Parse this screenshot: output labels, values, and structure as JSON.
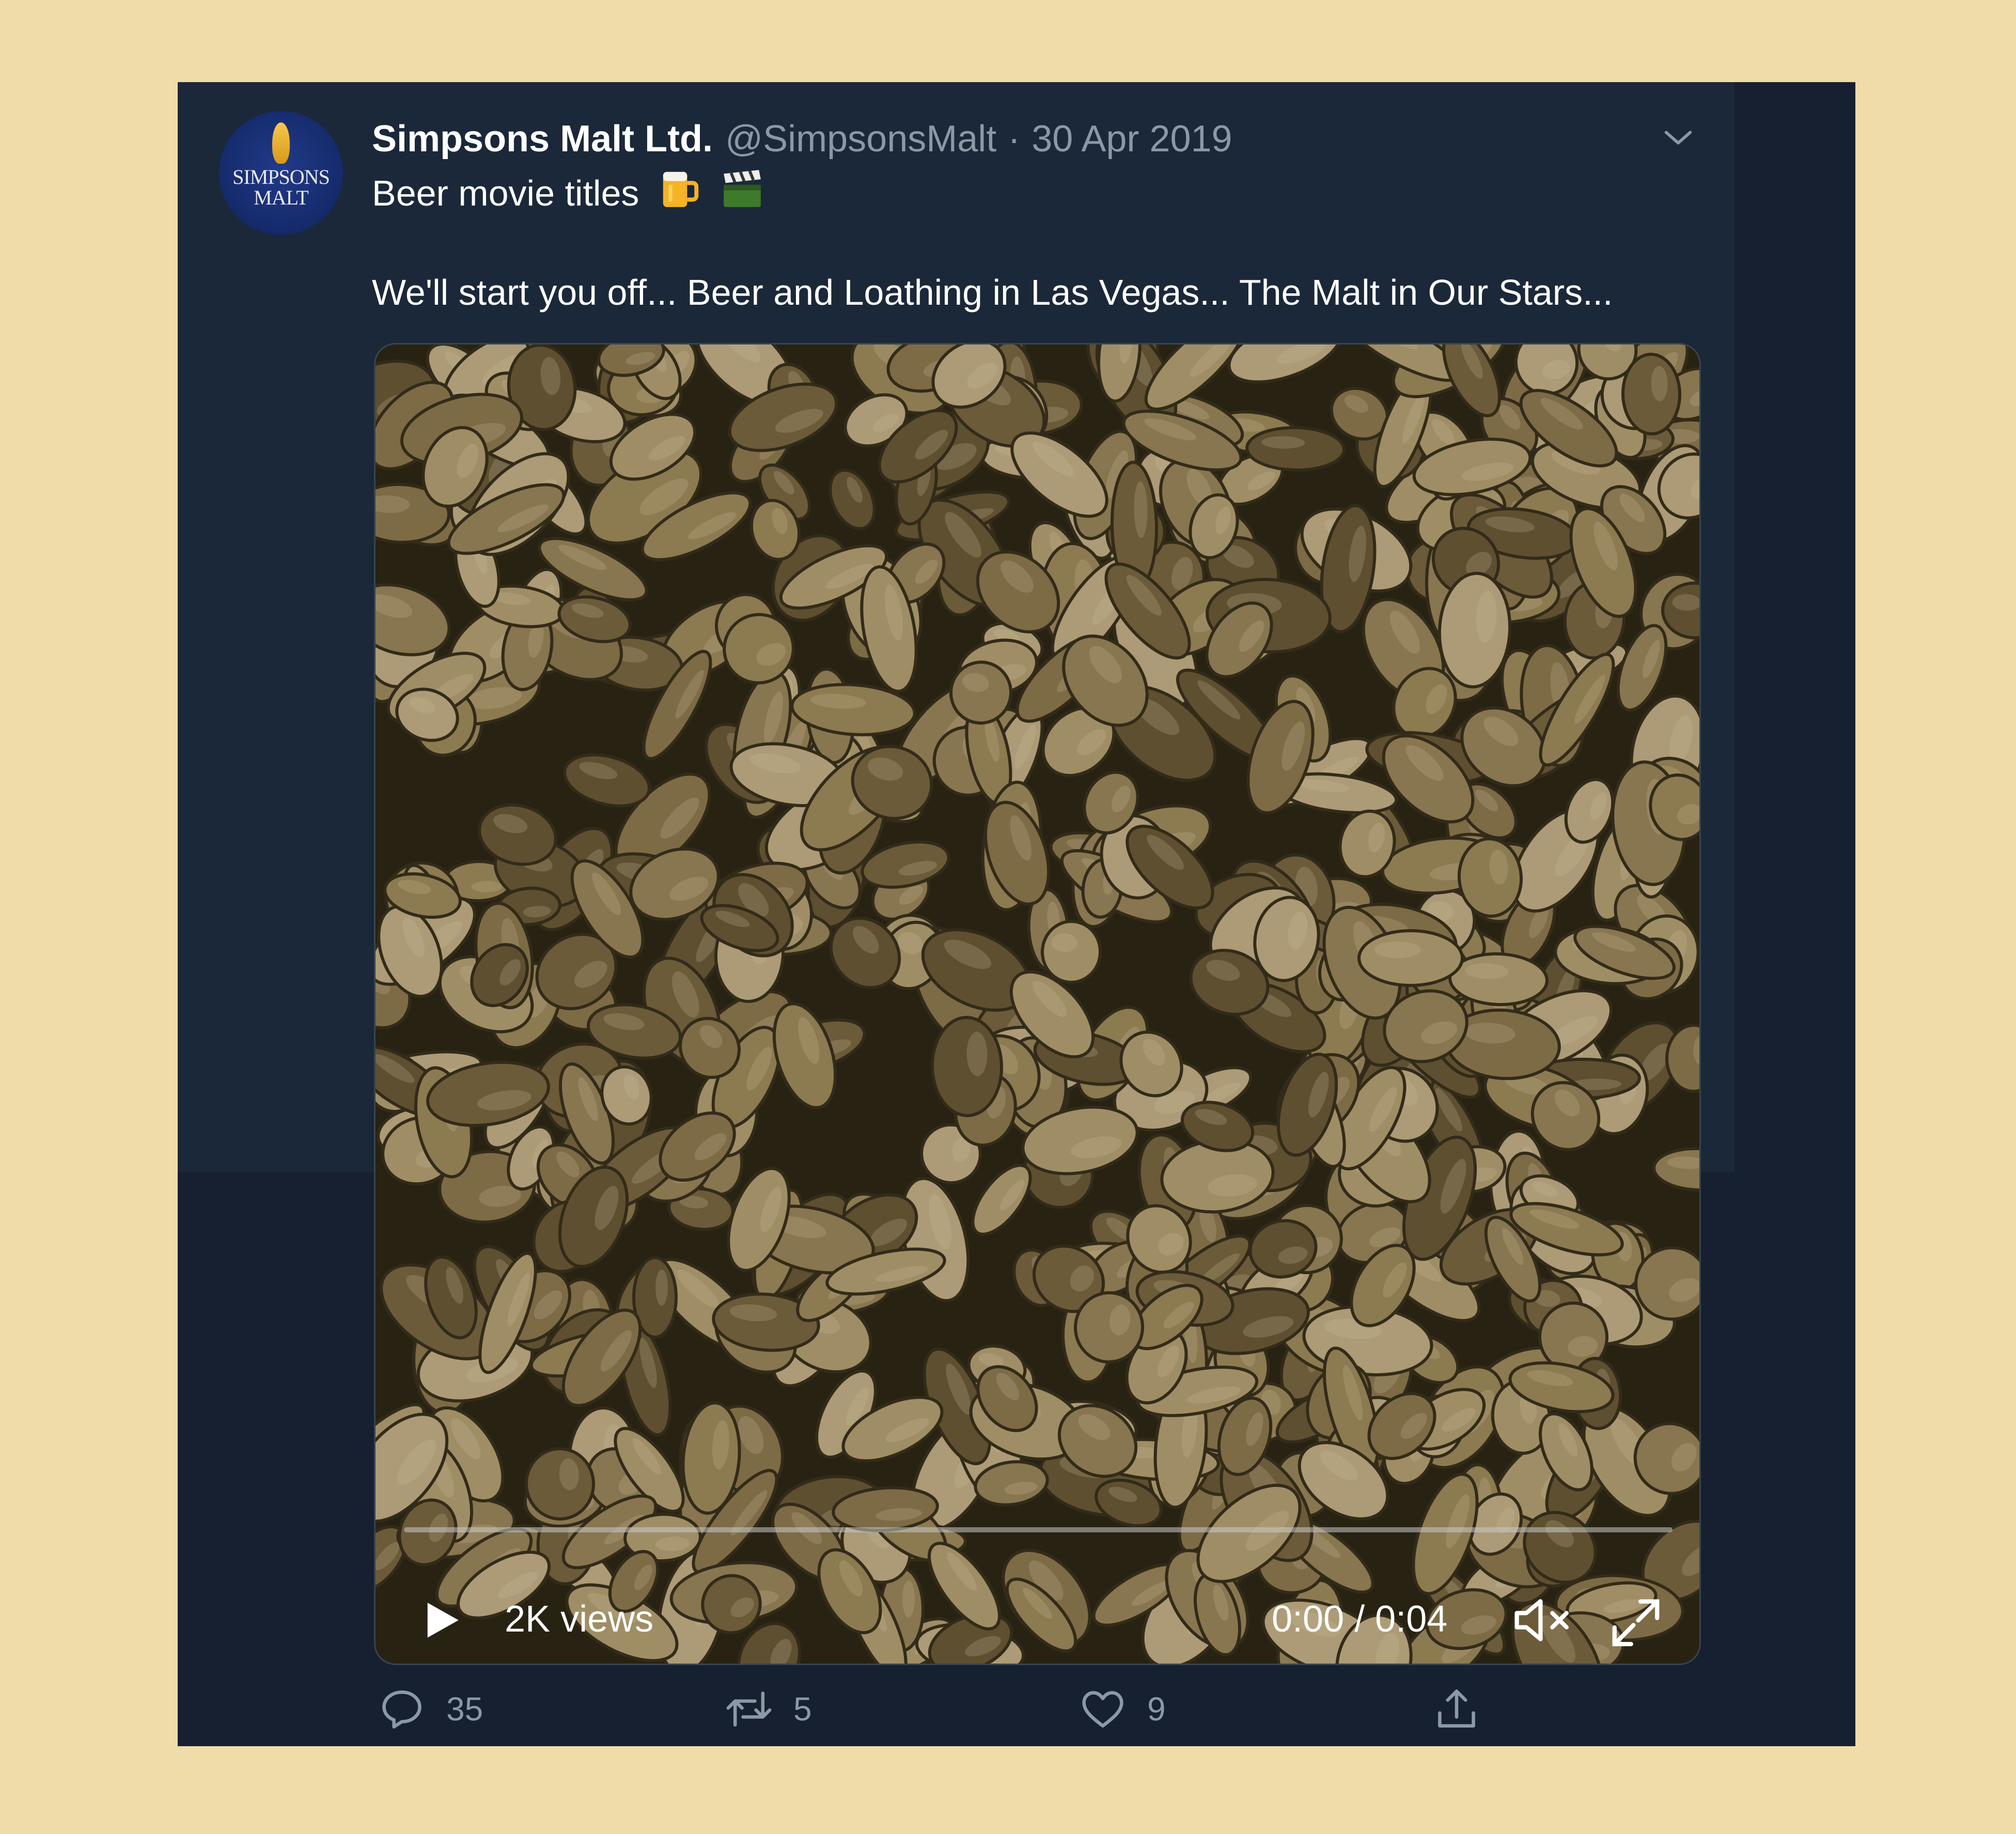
{
  "tweet": {
    "author_name": "Simpsons Malt Ltd.",
    "handle": "@SimpsonsMalt",
    "separator": "·",
    "date": "30 Apr 2019",
    "text_line1": "Beer movie titles",
    "emoji": [
      "beer-mug-emoji",
      "clapper-board-emoji"
    ],
    "text_line2": "We'll start you off... Beer and Loathing in Las Vegas... The Malt in Our Stars..."
  },
  "avatar": {
    "brand_text_line1": "SIMPSONS",
    "brand_text_line2": "MALT"
  },
  "video": {
    "views": "2K views",
    "time": "0:00 / 0:04",
    "progress": 0.0,
    "icons": [
      "play-icon",
      "mute-icon",
      "fullscreen-icon"
    ]
  },
  "actions": {
    "reply_count": "35",
    "retweet_count": "5",
    "like_count": "9",
    "icons": [
      "reply-icon",
      "retweet-icon",
      "like-icon",
      "share-icon"
    ]
  },
  "colors": {
    "page_background": "#f0dca8",
    "card_background": "#1b2839",
    "secondary_text": "#8b98a5",
    "primary_text": "#ffffff"
  }
}
